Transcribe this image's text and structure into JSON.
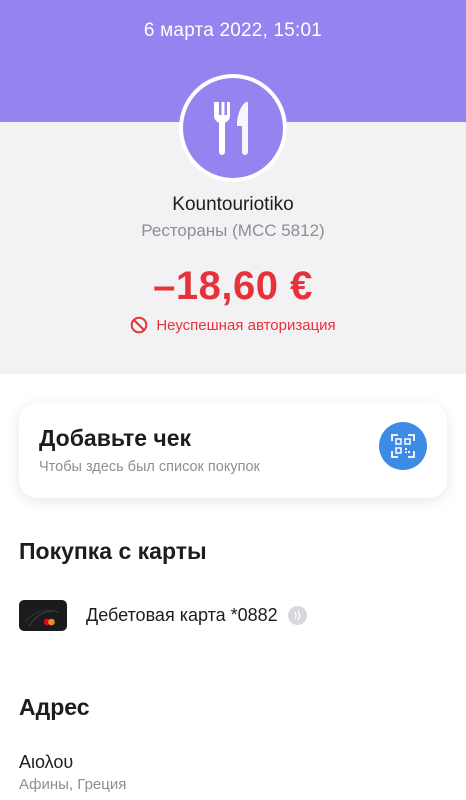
{
  "header": {
    "datetime": "6 марта 2022, 15:01"
  },
  "transaction": {
    "category_icon": "fork-knife-icon",
    "merchant": "Kountouriotiko",
    "category": "Рестораны (MCC 5812)",
    "amount": "–18,60 €",
    "status_icon": "forbidden-icon",
    "status": "Неуспешная авторизация"
  },
  "receipt": {
    "title": "Добавьте чек",
    "subtitle": "Чтобы здесь был список покупок",
    "action_icon": "qr-scan-icon"
  },
  "payment": {
    "section_title": "Покупка с карты",
    "card_icon": "card-icon",
    "card_name": "Дебетовая карта *0882",
    "contactless_icon": "contactless-icon"
  },
  "address": {
    "section_title": "Адрес",
    "street": "Αιολου",
    "city": "Афины, Греция"
  },
  "colors": {
    "accent_purple": "#9583f0",
    "danger_red": "#e8323a",
    "qr_blue": "#3e8be6",
    "muted_gray": "#8e8e93"
  }
}
